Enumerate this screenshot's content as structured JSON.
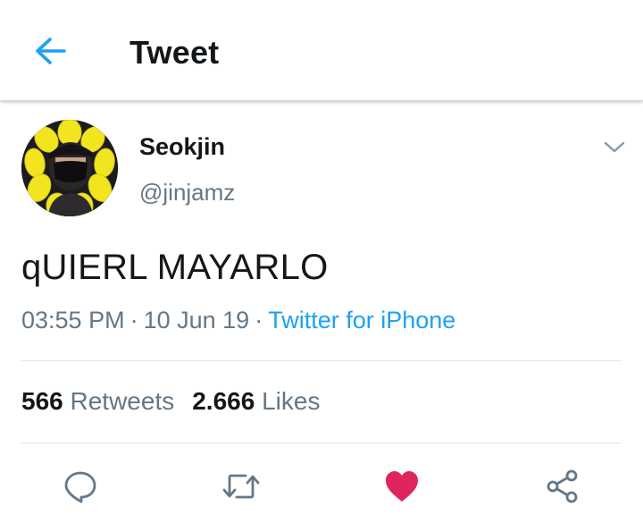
{
  "header": {
    "title": "Tweet",
    "back_icon": "arrow-left-icon",
    "accent_color": "#1da1f2"
  },
  "tweet": {
    "author": {
      "name": "Seokjin",
      "handle": "@jinjamz",
      "avatar": "sunflower-costume-avatar"
    },
    "text": "qUIERL MAYARLO",
    "time": "03:55 PM",
    "date": "10 Jun 19",
    "separator": "·",
    "source": "Twitter for iPhone",
    "retweets_count": "566",
    "retweets_label": "Retweets",
    "likes_count": "2.666",
    "likes_label": "Likes"
  },
  "actions": {
    "reply_icon": "reply-bubble-icon",
    "retweet_icon": "retweet-icon",
    "like_icon": "heart-icon",
    "like_active": true,
    "like_color": "#e0245e",
    "share_icon": "share-icon"
  }
}
